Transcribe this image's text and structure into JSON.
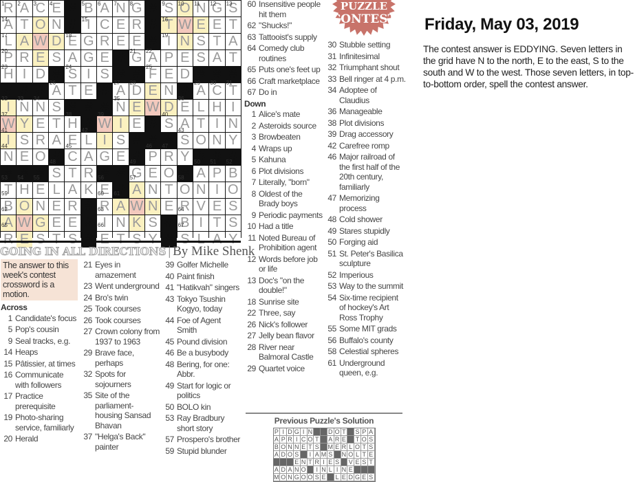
{
  "puzzle": {
    "title": "GOING IN ALL DIRECTIONS",
    "separator": "|",
    "byline": "By Mike Shenk",
    "grid_rows": [
      "RACE#BANG#SONGS",
      "ATON#ICER#TWEET",
      "LAWDEGREE#INSTA",
      "PRESAGE#GAPESAT",
      "HID#SIS##FED###",
      "###ATE#ADEN#ACT",
      "INNS###NEWDELHI",
      "WYETH#WIE#SATIN",
      "ISRAELIS###SONY",
      "NEO#CAGE#PRY###",
      "###STR##GEO#APB",
      "THELAKE#ANTONIO",
      "BONER#RAWNERVES",
      "AWGEE#INKS#BITS",
      "RESTS#ETSY#SLAY"
    ],
    "answer_cells": [
      [
        2,
        12
      ],
      [
        3,
        3
      ],
      [
        7,
        10
      ],
      [
        8,
        1
      ],
      [
        8,
        7
      ],
      [
        13,
        9
      ],
      [
        14,
        2
      ]
    ],
    "colors": {
      "answer_cell": "#f3c9bd",
      "direction_cell": "#fbf1c0"
    }
  },
  "intro": "The answer to this week's contest crossword is a motion.",
  "across_label": "Across",
  "down_label": "Down",
  "across": [
    {
      "n": "1",
      "t": "Candidate's focus"
    },
    {
      "n": "5",
      "t": "Pop's cousin"
    },
    {
      "n": "9",
      "t": "Seal tracks, e.g."
    },
    {
      "n": "14",
      "t": "Heaps"
    },
    {
      "n": "15",
      "t": "Pâtissier, at times"
    },
    {
      "n": "16",
      "t": "Communicate with followers"
    },
    {
      "n": "17",
      "t": "Practice prerequisite"
    },
    {
      "n": "19",
      "t": "Photo-sharing service, familiarly"
    },
    {
      "n": "20",
      "t": "Herald"
    },
    {
      "n": "21",
      "t": "Eyes in amazement"
    },
    {
      "n": "23",
      "t": "Went underground"
    },
    {
      "n": "24",
      "t": "Bro's twin"
    },
    {
      "n": "25",
      "t": "Took courses"
    },
    {
      "n": "26",
      "t": "Took courses"
    },
    {
      "n": "27",
      "t": "Crown colony from 1937 to 1963"
    },
    {
      "n": "29",
      "t": "Brave face, perhaps"
    },
    {
      "n": "32",
      "t": "Spots for sojourners"
    },
    {
      "n": "35",
      "t": "Site of the parliament-housing Sansad Bhavan"
    },
    {
      "n": "37",
      "t": "\"Helga's Back\" painter"
    },
    {
      "n": "39",
      "t": "Golfer Michelle"
    },
    {
      "n": "40",
      "t": "Paint finish"
    },
    {
      "n": "41",
      "t": "\"Hatikvah\" singers"
    },
    {
      "n": "43",
      "t": "Tokyo Tsushin Kogyo, today"
    },
    {
      "n": "44",
      "t": "Foe of Agent Smith"
    },
    {
      "n": "45",
      "t": "Pound division"
    },
    {
      "n": "46",
      "t": "Be a busybody"
    },
    {
      "n": "48",
      "t": "Bering, for one: Abbr."
    },
    {
      "n": "49",
      "t": "Start for logic or politics"
    },
    {
      "n": "50",
      "t": "BOLO kin"
    },
    {
      "n": "53",
      "t": "Ray Bradbury short story"
    },
    {
      "n": "57",
      "t": "Prospero's brother"
    },
    {
      "n": "59",
      "t": "Stupid blunder"
    },
    {
      "n": "60",
      "t": "Insensitive people hit them"
    },
    {
      "n": "62",
      "t": "\"Shucks!\""
    },
    {
      "n": "63",
      "t": "Tattooist's supply"
    },
    {
      "n": "64",
      "t": "Comedy club routines"
    },
    {
      "n": "65",
      "t": "Puts one's feet up"
    },
    {
      "n": "66",
      "t": "Craft marketplace"
    },
    {
      "n": "67",
      "t": "Do in"
    }
  ],
  "down": [
    {
      "n": "1",
      "t": "Alice's mate"
    },
    {
      "n": "2",
      "t": "Asteroids source"
    },
    {
      "n": "3",
      "t": "Browbeaten"
    },
    {
      "n": "4",
      "t": "Wraps up"
    },
    {
      "n": "5",
      "t": "Kahuna"
    },
    {
      "n": "6",
      "t": "Plot divisions"
    },
    {
      "n": "7",
      "t": "Literally, \"born\""
    },
    {
      "n": "8",
      "t": "Oldest of the Brady boys"
    },
    {
      "n": "9",
      "t": "Periodic payments"
    },
    {
      "n": "10",
      "t": "Had a title"
    },
    {
      "n": "11",
      "t": "Noted Bureau of Prohibition agent"
    },
    {
      "n": "12",
      "t": "Words before job or life"
    },
    {
      "n": "13",
      "t": "Doc's \"on the double!\""
    },
    {
      "n": "18",
      "t": "Sunrise site"
    },
    {
      "n": "22",
      "t": "Three, say"
    },
    {
      "n": "26",
      "t": "Nick's follower"
    },
    {
      "n": "27",
      "t": "Jelly bean flavor"
    },
    {
      "n": "28",
      "t": "River near Balmoral Castle"
    },
    {
      "n": "29",
      "t": "Quartet voice"
    },
    {
      "n": "30",
      "t": "Stubble setting"
    },
    {
      "n": "31",
      "t": "Infinitesimal"
    },
    {
      "n": "32",
      "t": "Triumphant shout"
    },
    {
      "n": "33",
      "t": "Bell ringer at 4 p.m."
    },
    {
      "n": "34",
      "t": "Adoptee of Claudius"
    },
    {
      "n": "36",
      "t": "Manageable"
    },
    {
      "n": "38",
      "t": "Plot divisions"
    },
    {
      "n": "39",
      "t": "Drag accessory"
    },
    {
      "n": "42",
      "t": "Carefree romp"
    },
    {
      "n": "46",
      "t": "Major railroad of the first half of the 20th century, familiarly"
    },
    {
      "n": "47",
      "t": "Memorizing process"
    },
    {
      "n": "48",
      "t": "Cold shower"
    },
    {
      "n": "49",
      "t": "Stares stupidly"
    },
    {
      "n": "50",
      "t": "Forging aid"
    },
    {
      "n": "51",
      "t": "St. Peter's Basilica sculpture"
    },
    {
      "n": "52",
      "t": "Imperious"
    },
    {
      "n": "53",
      "t": "Way to the summit"
    },
    {
      "n": "54",
      "t": "Six-time recipient of hockey's Art Ross Trophy"
    },
    {
      "n": "55",
      "t": "Some MIT grads"
    },
    {
      "n": "56",
      "t": "Buffalo's county"
    },
    {
      "n": "58",
      "t": "Celestial spheres"
    },
    {
      "n": "61",
      "t": "Underground queen, e.g."
    }
  ],
  "logo": {
    "line1": "PUZZLE",
    "line2": "CONTEST",
    "color": "#c8736a"
  },
  "date": "Friday, May 03, 2019",
  "answer_text": "The contest answer is EDDYING. Seven letters in the grid have N to the north, E to the east, S to the south and W to the west. Those seven letters, in top-to-bottom order, spell the contest answer.",
  "previous": {
    "heading": "Previous Puzzle's Solution",
    "rows": [
      "PIDGIN##DOT#SPA",
      "APRICOT#ARE#TOS",
      "BONNETS#MERLOTS",
      "ADOS#IAMS#NOLTE",
      "###ENTRIES#VEST",
      "ADANO#INLINE###",
      "MONGOOSE#LEDGES"
    ]
  }
}
